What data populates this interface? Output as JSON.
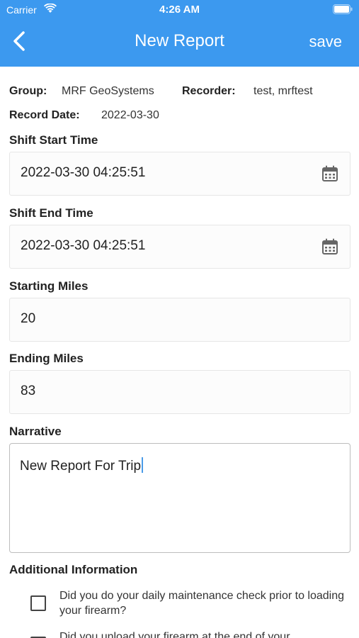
{
  "status_bar": {
    "carrier": "Carrier",
    "time": "4:26 AM"
  },
  "header": {
    "title": "New Report",
    "save_label": "save",
    "back_icon": "chevron-left-icon"
  },
  "meta": {
    "group_label": "Group:",
    "group_value": "MRF GeoSystems",
    "recorder_label": "Recorder:",
    "recorder_value": "test, mrftest",
    "record_date_label": "Record Date:",
    "record_date_value": "2022-03-30"
  },
  "fields": {
    "shift_start": {
      "label": "Shift Start Time",
      "value": "2022-03-30 04:25:51"
    },
    "shift_end": {
      "label": "Shift End Time",
      "value": "2022-03-30 04:25:51"
    },
    "starting_miles": {
      "label": "Starting Miles",
      "value": "20"
    },
    "ending_miles": {
      "label": "Ending Miles",
      "value": "83"
    },
    "narrative": {
      "label": "Narrative",
      "value": "New Report For Trip"
    }
  },
  "additional": {
    "heading": "Additional Information",
    "items": [
      {
        "text": "Did you do your daily maintenance check prior to loading your firearm?",
        "checked": false
      },
      {
        "text": "Did you unload your firearm at the end of your",
        "checked": false
      }
    ]
  },
  "colors": {
    "accent": "#3c99ef"
  }
}
